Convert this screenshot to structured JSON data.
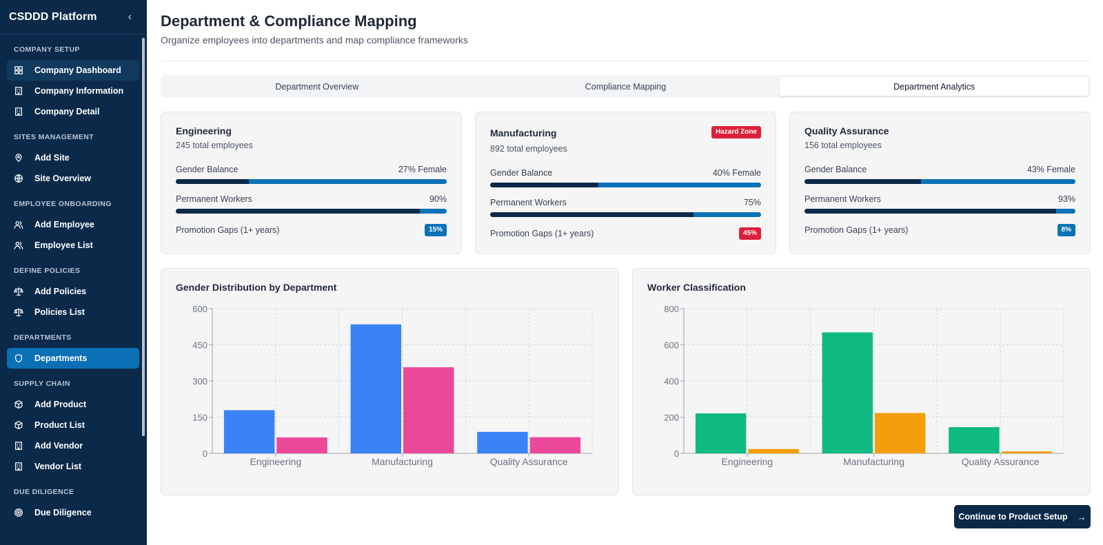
{
  "sidebar": {
    "title": "CSDDD Platform",
    "collapse_icon": "chevron-left-icon",
    "sections": [
      {
        "label": "COMPANY SETUP",
        "items": [
          {
            "label": "Company Dashboard",
            "icon": "dashboard-grid-icon"
          },
          {
            "label": "Company Information",
            "icon": "building-icon"
          },
          {
            "label": "Company Detail",
            "icon": "building-icon"
          }
        ]
      },
      {
        "label": "SITES MANAGEMENT",
        "items": [
          {
            "label": "Add Site",
            "icon": "map-pin-icon"
          },
          {
            "label": "Site Overview",
            "icon": "globe-icon"
          }
        ]
      },
      {
        "label": "EMPLOYEE ONBOARDING",
        "items": [
          {
            "label": "Add Employee",
            "icon": "users-icon"
          },
          {
            "label": "Employee List",
            "icon": "users-icon"
          }
        ]
      },
      {
        "label": "DEFINE POLICIES",
        "items": [
          {
            "label": "Add Policies",
            "icon": "scale-icon"
          },
          {
            "label": "Policies List",
            "icon": "scale-icon"
          }
        ]
      },
      {
        "label": "DEPARTMENTS",
        "items": [
          {
            "label": "Departments",
            "icon": "shield-icon"
          }
        ]
      },
      {
        "label": "SUPPLY CHAIN",
        "items": [
          {
            "label": "Add Product",
            "icon": "package-icon"
          },
          {
            "label": "Product List",
            "icon": "package-icon"
          },
          {
            "label": "Add Vendor",
            "icon": "building-icon"
          },
          {
            "label": "Vendor List",
            "icon": "building-icon"
          }
        ]
      },
      {
        "label": "DUE DILIGENCE",
        "items": [
          {
            "label": "Due Diligence",
            "icon": "target-icon"
          }
        ]
      }
    ]
  },
  "header": {
    "title": "Department & Compliance Mapping",
    "subtitle": "Organize employees into departments and map compliance frameworks"
  },
  "tabs": [
    "Department Overview",
    "Compliance Mapping",
    "Department Analytics"
  ],
  "selected_tab": "Department Analytics",
  "departments": [
    {
      "name": "Engineering",
      "employees": "245 total employees",
      "gender_label": "Gender Balance",
      "gender_value": "27% Female",
      "gender_fraction": 0.27,
      "permanent_label": "Permanent Workers",
      "permanent_value": "90%",
      "permanent_fraction": 0.9,
      "promotion_label": "Promotion Gaps (1+ years)",
      "promotion_value": "15%",
      "promotion_color": "#0a72b8"
    },
    {
      "name": "Manufacturing",
      "badge": "Hazard Zone",
      "employees": "892 total employees",
      "gender_label": "Gender Balance",
      "gender_value": "40% Female",
      "gender_fraction": 0.4,
      "permanent_label": "Permanent Workers",
      "permanent_value": "75%",
      "permanent_fraction": 0.75,
      "promotion_label": "Promotion Gaps (1+ years)",
      "promotion_value": "45%",
      "promotion_color": "#dc1f3a"
    },
    {
      "name": "Quality Assurance",
      "employees": "156 total employees",
      "gender_label": "Gender Balance",
      "gender_value": "43% Female",
      "gender_fraction": 0.43,
      "permanent_label": "Permanent Workers",
      "permanent_value": "93%",
      "permanent_fraction": 0.93,
      "promotion_label": "Promotion Gaps (1+ years)",
      "promotion_value": "8%",
      "promotion_color": "#0a72b8"
    }
  ],
  "chart_data": [
    {
      "type": "bar",
      "title": "Gender Distribution by Department",
      "categories": [
        "Engineering",
        "Manufacturing",
        "Quality Assurance"
      ],
      "series": [
        {
          "values": [
            179,
            535,
            89
          ],
          "color": "#3b82f6"
        },
        {
          "values": [
            66,
            357,
            67
          ],
          "color": "#ec4899"
        }
      ],
      "ylim": [
        0,
        600
      ],
      "yticks": [
        0,
        150,
        300,
        450,
        600
      ],
      "grid": true
    },
    {
      "type": "bar",
      "title": "Worker Classification",
      "categories": [
        "Engineering",
        "Manufacturing",
        "Quality Assurance"
      ],
      "series": [
        {
          "values": [
            221,
            669,
            145
          ],
          "color": "#10b981"
        },
        {
          "values": [
            24,
            223,
            11
          ],
          "color": "#f59e0b"
        }
      ],
      "ylim": [
        0,
        800
      ],
      "yticks": [
        0,
        200,
        400,
        600,
        800
      ],
      "grid": true
    }
  ],
  "cta": {
    "label": "Continue to Product Setup",
    "icon": "arrow-right-icon"
  }
}
